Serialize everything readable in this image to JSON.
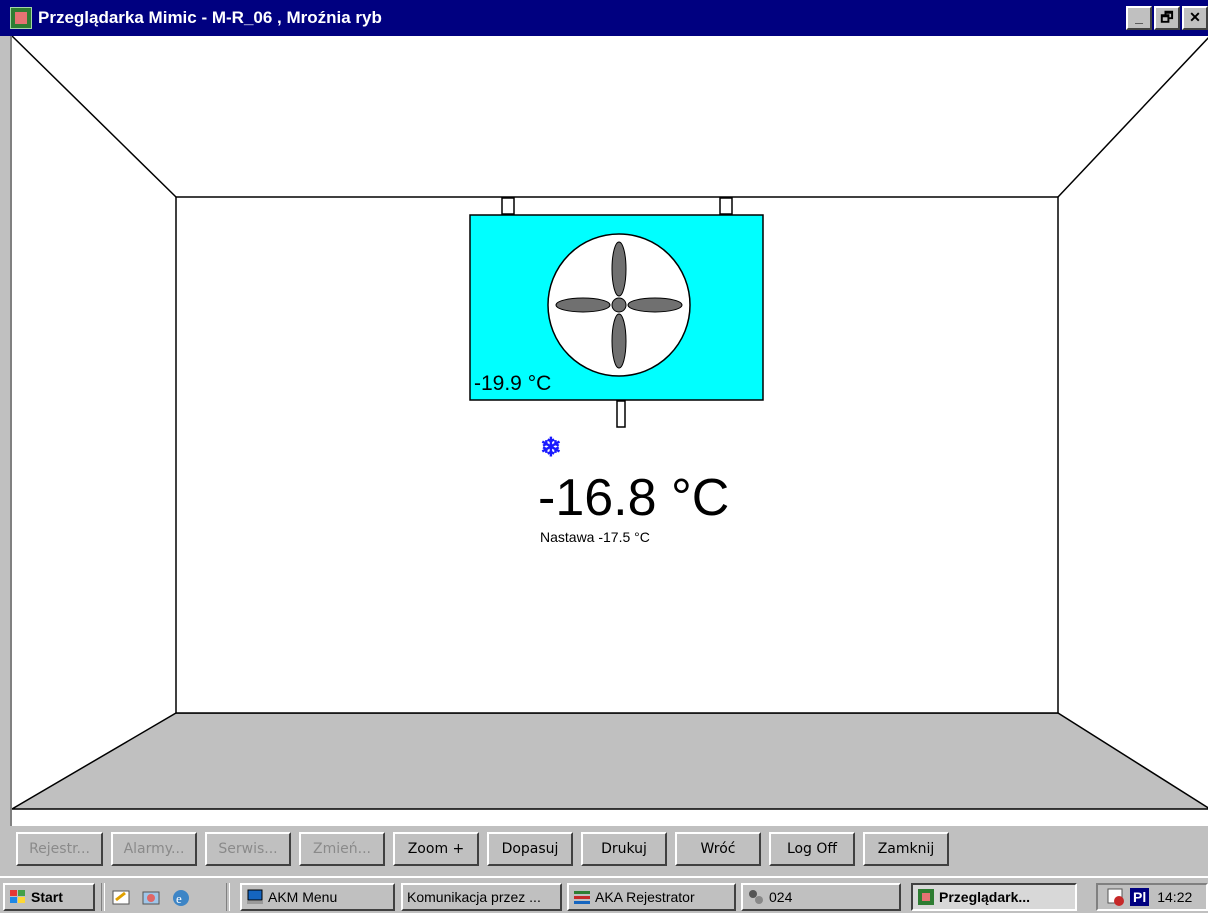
{
  "window": {
    "title": "Przeglądarka Mimic - M-R_06 , Mroźnia ryb",
    "controls": [
      "_",
      "🗗",
      "✕"
    ]
  },
  "mimic": {
    "unit_temp": "-19.9 °C",
    "room_temp": "-16.8 °C",
    "setpoint": "Nastawa -17.5 °C",
    "unit_color": "#00ffff",
    "floor_color": "#c0c0c0",
    "defrost_icon": "snowflake-icon"
  },
  "buttons": [
    {
      "label": "Rejestr...",
      "enabled": false
    },
    {
      "label": "Alarmy...",
      "enabled": false
    },
    {
      "label": "Serwis...",
      "enabled": false
    },
    {
      "label": "Zmień...",
      "enabled": false
    },
    {
      "label": "Zoom +",
      "enabled": true
    },
    {
      "label": "Dopasuj",
      "enabled": true
    },
    {
      "label": "Drukuj",
      "enabled": true
    },
    {
      "label": "Wróć",
      "enabled": true
    },
    {
      "label": "Log Off",
      "enabled": true
    },
    {
      "label": "Zamknij",
      "enabled": true
    }
  ],
  "taskbar": {
    "start": "Start",
    "items": [
      "AKM Menu",
      "Komunikacja przez ...",
      "AKA Rejestrator",
      "024",
      "Przeglądark..."
    ],
    "tray_lang": "Pl",
    "clock": "14:22"
  }
}
